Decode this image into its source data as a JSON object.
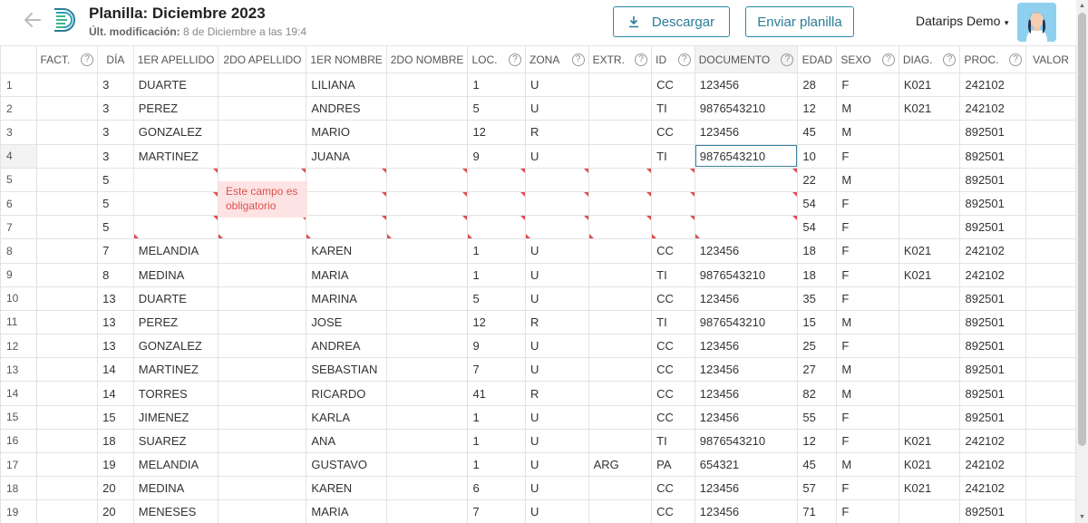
{
  "header": {
    "title": "Planilla: Diciembre 2023",
    "subtitle_label": "Últ. modificación:",
    "subtitle_value": "8 de Diciembre a las 19:4",
    "download_label": "Descargar",
    "send_label": "Enviar planilla",
    "user_name": "Datarips Demo",
    "accent_color": "#2a7d96"
  },
  "grid": {
    "columns": [
      {
        "label": "",
        "help": false
      },
      {
        "label": "FACT.",
        "help": true
      },
      {
        "label": "DÍA",
        "help": false
      },
      {
        "label": "1ER APELLIDO",
        "help": false
      },
      {
        "label": "2DO APELLIDO",
        "help": false
      },
      {
        "label": "1ER NOMBRE",
        "help": false
      },
      {
        "label": "2DO NOMBRE",
        "help": false
      },
      {
        "label": "LOC.",
        "help": true
      },
      {
        "label": "ZONA",
        "help": true
      },
      {
        "label": "EXTR.",
        "help": true
      },
      {
        "label": "ID",
        "help": true
      },
      {
        "label": "DOCUMENTO",
        "help": true
      },
      {
        "label": "EDAD",
        "help": false
      },
      {
        "label": "SEXO",
        "help": true
      },
      {
        "label": "DIAG.",
        "help": true
      },
      {
        "label": "PROC.",
        "help": true
      },
      {
        "label": "VALOR",
        "help": false
      }
    ],
    "rows": [
      [
        "1",
        "",
        "3",
        "DUARTE",
        "",
        "LILIANA",
        "",
        "1",
        "U",
        "",
        "CC",
        "123456",
        "28",
        "F",
        "K021",
        "242102",
        ""
      ],
      [
        "2",
        "",
        "3",
        "PEREZ",
        "",
        "ANDRES",
        "",
        "5",
        "U",
        "",
        "TI",
        "9876543210",
        "12",
        "M",
        "K021",
        "242102",
        ""
      ],
      [
        "3",
        "",
        "3",
        "GONZALEZ",
        "",
        "MARIO",
        "",
        "12",
        "R",
        "",
        "CC",
        "123456",
        "45",
        "M",
        "",
        "892501",
        ""
      ],
      [
        "4",
        "",
        "3",
        "MARTINEZ",
        "",
        "JUANA",
        "",
        "9",
        "U",
        "",
        "TI",
        "9876543210",
        "10",
        "F",
        "",
        "892501",
        ""
      ],
      [
        "5",
        "",
        "5",
        "",
        "",
        "",
        "",
        "",
        "",
        "",
        "",
        "",
        "22",
        "M",
        "",
        "892501",
        ""
      ],
      [
        "6",
        "",
        "5",
        "",
        "",
        "",
        "",
        "",
        "",
        "",
        "",
        "",
        "54",
        "F",
        "",
        "892501",
        ""
      ],
      [
        "7",
        "",
        "5",
        "",
        "",
        "",
        "",
        "",
        "",
        "",
        "",
        "",
        "54",
        "F",
        "",
        "892501",
        ""
      ],
      [
        "8",
        "",
        "7",
        "MELANDIA",
        "",
        "KAREN",
        "",
        "1",
        "U",
        "",
        "CC",
        "123456",
        "18",
        "F",
        "K021",
        "242102",
        ""
      ],
      [
        "9",
        "",
        "8",
        "MEDINA",
        "",
        "MARIA",
        "",
        "1",
        "U",
        "",
        "TI",
        "9876543210",
        "18",
        "F",
        "K021",
        "242102",
        ""
      ],
      [
        "10",
        "",
        "13",
        "DUARTE",
        "",
        "MARINA",
        "",
        "5",
        "U",
        "",
        "CC",
        "123456",
        "35",
        "F",
        "",
        "892501",
        ""
      ],
      [
        "11",
        "",
        "13",
        "PEREZ",
        "",
        "JOSE",
        "",
        "12",
        "R",
        "",
        "TI",
        "9876543210",
        "15",
        "M",
        "",
        "892501",
        ""
      ],
      [
        "12",
        "",
        "13",
        "GONZALEZ",
        "",
        "ANDREA",
        "",
        "9",
        "U",
        "",
        "CC",
        "123456",
        "25",
        "F",
        "",
        "892501",
        ""
      ],
      [
        "13",
        "",
        "14",
        "MARTINEZ",
        "",
        "SEBASTIAN",
        "",
        "7",
        "U",
        "",
        "CC",
        "123456",
        "27",
        "M",
        "",
        "892501",
        ""
      ],
      [
        "14",
        "",
        "14",
        "TORRES",
        "",
        "RICARDO",
        "",
        "41",
        "R",
        "",
        "CC",
        "123456",
        "82",
        "M",
        "",
        "892501",
        ""
      ],
      [
        "15",
        "",
        "15",
        "JIMENEZ",
        "",
        "KARLA",
        "",
        "1",
        "U",
        "",
        "CC",
        "123456",
        "55",
        "F",
        "",
        "892501",
        ""
      ],
      [
        "16",
        "",
        "18",
        "SUAREZ",
        "",
        "ANA",
        "",
        "1",
        "U",
        "",
        "TI",
        "9876543210",
        "12",
        "F",
        "K021",
        "242102",
        ""
      ],
      [
        "17",
        "",
        "19",
        "MELANDIA",
        "",
        "GUSTAVO",
        "",
        "1",
        "U",
        "ARG",
        "PA",
        "654321",
        "45",
        "M",
        "K021",
        "242102",
        ""
      ],
      [
        "18",
        "",
        "20",
        "MEDINA",
        "",
        "KAREN",
        "",
        "6",
        "U",
        "",
        "CC",
        "123456",
        "57",
        "F",
        "K021",
        "242102",
        ""
      ],
      [
        "19",
        "",
        "20",
        "MENESES",
        "",
        "MARIA",
        "",
        "7",
        "U",
        "",
        "CC",
        "123456",
        "71",
        "F",
        "",
        "892501",
        ""
      ]
    ],
    "error_tooltip": "Este campo es obligatorio",
    "error_color": "#e24c4c"
  }
}
